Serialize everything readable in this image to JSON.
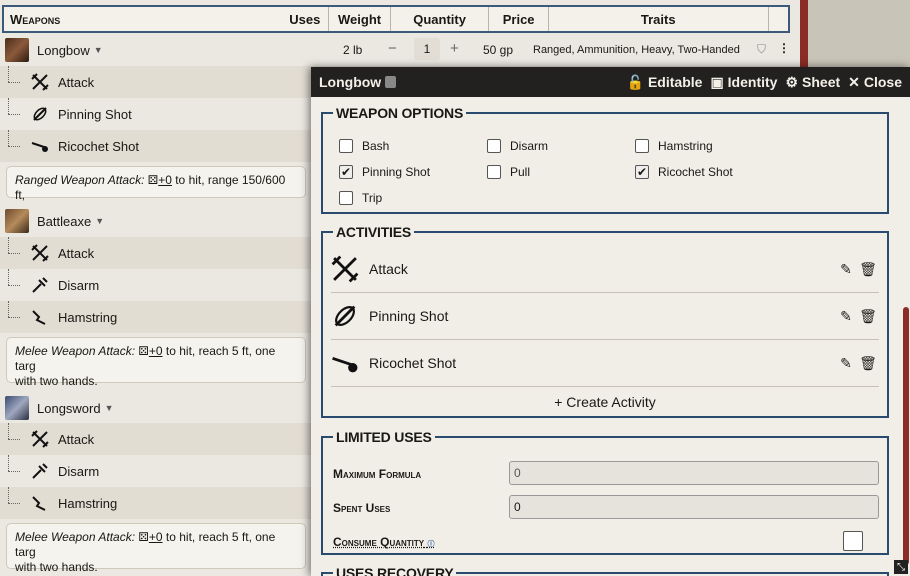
{
  "table": {
    "headers": {
      "weapons": "Weapons",
      "uses": "Uses",
      "weight": "Weight",
      "quantity": "Quantity",
      "price": "Price",
      "traits": "Traits"
    }
  },
  "items": [
    {
      "name": "Longbow",
      "weight": "2 lb",
      "quantity": "1",
      "qty_minus": "−",
      "qty_plus": "+",
      "price": "50 gp",
      "traits": "Ranged, Ammunition, Heavy, Two-Handed",
      "activities": [
        "Attack",
        "Pinning Shot",
        "Ricochet Shot"
      ],
      "desc_italic": "Ranged Weapon Attack:",
      "desc_bonus": "+0",
      "desc_rest": " to hit, range 150/600 ft,",
      "desc_line2": ""
    },
    {
      "name": "Battleaxe",
      "activities": [
        "Attack",
        "Disarm",
        "Hamstring"
      ],
      "desc_italic": "Melee Weapon Attack:",
      "desc_bonus": "+0",
      "desc_rest": " to hit, reach 5 ft, one targ",
      "desc_line2": "with two hands."
    },
    {
      "name": "Longsword",
      "activities": [
        "Attack",
        "Disarm",
        "Hamstring"
      ],
      "desc_italic": "Melee Weapon Attack:",
      "desc_bonus": "+0",
      "desc_rest": " to hit, reach 5 ft, one targ",
      "desc_line2": "with two hands."
    }
  ],
  "dialog": {
    "title": "Longbow",
    "editable": "Editable",
    "identity": "Identity",
    "sheet": "Sheet",
    "close": "Close",
    "weapon_options_legend": "Weapon Options",
    "weapon_options": [
      {
        "label": "Bash",
        "checked": false
      },
      {
        "label": "Disarm",
        "checked": false
      },
      {
        "label": "Hamstring",
        "checked": false
      },
      {
        "label": "Pinning Shot",
        "checked": true
      },
      {
        "label": "Pull",
        "checked": false
      },
      {
        "label": "Ricochet Shot",
        "checked": true
      },
      {
        "label": "Trip",
        "checked": false
      }
    ],
    "activities_legend": "Activities",
    "activities": [
      "Attack",
      "Pinning Shot",
      "Ricochet Shot"
    ],
    "create_activity": "Create Activity",
    "limited_uses_legend": "Limited Uses",
    "max_formula_label": "Maximum Formula",
    "max_formula_placeholder": "0",
    "spent_uses_label": "Spent Uses",
    "spent_uses_value": "0",
    "consume_quantity_label": "Consume Quantity",
    "uses_recovery_legend": "Uses Recovery"
  },
  "colors": {
    "accent": "#2b4a6f",
    "titlebar": "#222120",
    "scroll": "#8b2d26"
  }
}
